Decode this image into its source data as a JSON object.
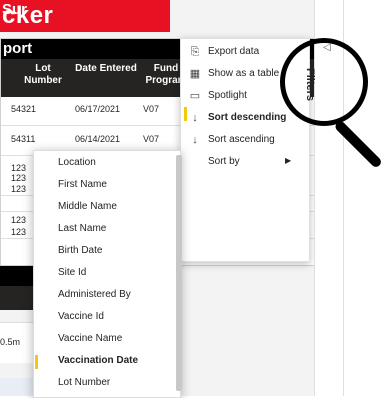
{
  "app": {
    "title_fragment": "cker",
    "report_title_fragment": "port",
    "summary_title_fragment": "Sur",
    "summary_value_fragment": "0.5m"
  },
  "table": {
    "columns": [
      "Lot Number",
      "Date Entered",
      "Fund Program"
    ],
    "rows": [
      {
        "lot": "54321",
        "date": "06/17/2021",
        "fund": "V07"
      },
      {
        "lot": "54311",
        "date": "06/14/2021",
        "fund": "V07"
      },
      {
        "lot": "123",
        "date": "",
        "fund": ""
      },
      {
        "lot": "123",
        "date": "",
        "fund": ""
      },
      {
        "lot": "123",
        "date": "",
        "fund": ""
      },
      {
        "lot": "123",
        "date": "",
        "fund": ""
      },
      {
        "lot": "123",
        "date": "",
        "fund": ""
      }
    ]
  },
  "context_menu": {
    "items": [
      {
        "label": "Export data",
        "icon": "export-icon",
        "glyph": "⎘"
      },
      {
        "label": "Show as a table",
        "icon": "table-icon",
        "glyph": "▦"
      },
      {
        "label": "Spotlight",
        "icon": "spotlight-icon",
        "glyph": "▭"
      },
      {
        "label": "Sort descending",
        "icon": "sort-descending-icon",
        "glyph": "↓",
        "active": true
      },
      {
        "label": "Sort ascending",
        "icon": "sort-ascending-icon",
        "glyph": "↓"
      },
      {
        "label": "Sort by",
        "icon": "",
        "glyph": "",
        "has_submenu": true
      }
    ]
  },
  "sort_by_menu": {
    "items": [
      "Location",
      "First Name",
      "Middle Name",
      "Last Name",
      "Birth Date",
      "Site Id",
      "Administered By",
      "Vaccine Id",
      "Vaccine Name",
      "Vaccination Date",
      "Lot Number"
    ],
    "selected": "Vaccination Date"
  },
  "filters_pane": {
    "label": "Filters"
  },
  "colors": {
    "brand_red": "#e81123",
    "header_dark": "#252423",
    "accent_yellow": "#f2c811"
  }
}
